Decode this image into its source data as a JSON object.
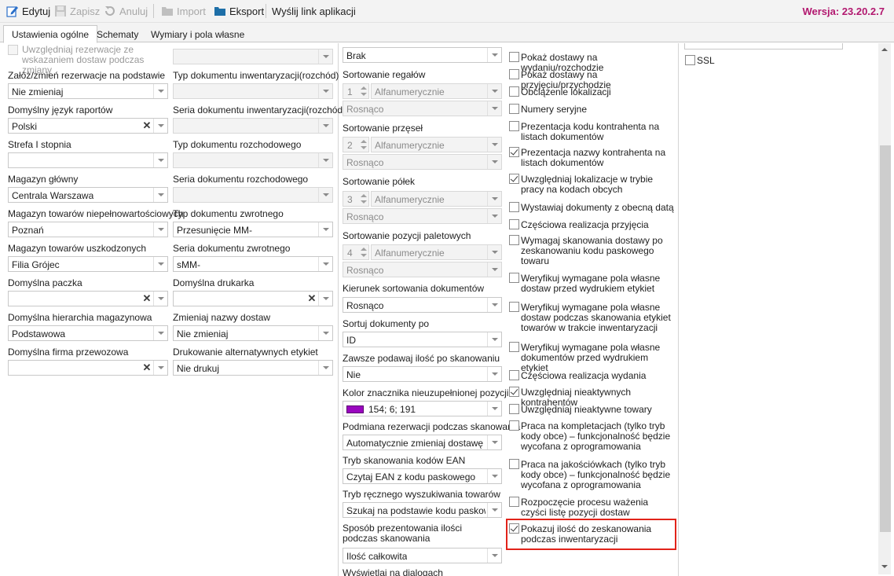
{
  "toolbar": {
    "edit": "Edytuj",
    "save": "Zapisz",
    "cancel": "Anuluj",
    "import": "Import",
    "export": "Eksport",
    "send_link": "Wyślij link aplikacji",
    "version": "Wersja: 23.20.2.7"
  },
  "tabs": [
    "Ustawienia ogólne",
    "Schematy",
    "Wymiary i pola własne"
  ],
  "col1": {
    "top_checkbox": "Uwzględniaj rezerwacje ze wskazaniem dostaw podczas zmiany",
    "l1": "Załóż/zmień rezerwacje na podstawie",
    "v1": "Nie zmieniaj",
    "l2": "Domyślny język raportów",
    "v2": "Polski",
    "l3": "Strefa I stopnia",
    "v3": "",
    "l4": "Magazyn główny",
    "v4": "Centrala Warszawa",
    "l5": "Magazyn towarów niepełnowartościowych",
    "v5": "Poznań",
    "l6": "Magazyn towarów uszkodzonych",
    "v6": "Filia Grójec",
    "l7": "Domyślna paczka",
    "v7": "",
    "l8": "Domyślna hierarchia magazynowa",
    "v8": "Podstawowa",
    "l9": "Domyślna firma przewozowa",
    "v9": ""
  },
  "col2": {
    "v0": "",
    "l1": "Typ dokumentu inwentaryzacji(rozchód)",
    "v1": "",
    "l2": "Seria dokumentu inwentaryzacji(rozchód)",
    "v2": "",
    "l3": "Typ dokumentu rozchodowego",
    "v3": "",
    "l4": "Seria dokumentu rozchodowego",
    "v4": "",
    "l5": "Typ dokumentu zwrotnego",
    "v5": "Przesunięcie MM-",
    "l6": "Seria dokumentu zwrotnego",
    "v6": "sMM-",
    "l7": "Domyślna drukarka",
    "v7": "",
    "l8": "Zmieniaj nazwy dostaw",
    "v8": "Nie zmieniaj",
    "l9": "Drukowanie alternatywnych etykiet",
    "v9": "Nie drukuj"
  },
  "col3": {
    "v0": "Brak",
    "sort_regaly": "Sortowanie regałów",
    "sort_regaly_n": "1",
    "sort_regaly_type": "Alfanumerycznie",
    "sort_regaly_dir": "Rosnąco",
    "sort_przesla": "Sortowanie przęseł",
    "sort_przesla_n": "2",
    "sort_przesla_type": "Alfanumerycznie",
    "sort_przesla_dir": "Rosnąco",
    "sort_polki": "Sortowanie półek",
    "sort_polki_n": "3",
    "sort_polki_type": "Alfanumerycznie",
    "sort_polki_dir": "Rosnąco",
    "sort_palety": "Sortowanie pozycji paletowych",
    "sort_palety_n": "4",
    "sort_palety_type": "Alfanumerycznie",
    "sort_palety_dir": "Rosnąco",
    "kierunek": "Kierunek sortowania dokumentów",
    "kierunek_v": "Rosnąco",
    "sortuj": "Sortuj dokumenty po",
    "sortuj_v": "ID",
    "zawsze": "Zawsze podawaj ilość po skanowaniu",
    "zawsze_v": "Nie",
    "kolor": "Kolor znacznika nieuzupełnionej pozycji",
    "kolor_v": "154; 6; 191",
    "kolor_hex": "#9a06bf",
    "podmiana": "Podmiana rezerwacji podczas skanowania",
    "podmiana_v": "Automatycznie zmieniaj dostawę po...",
    "tryb_ean": "Tryb skanowania kodów EAN",
    "tryb_ean_v": "Czytaj EAN z kodu paskowego",
    "tryb_reczny": "Tryb ręcznego wyszukiwania towarów",
    "tryb_reczny_v": "Szukaj na podstawie kodu paskowe...",
    "sposob": "Sposób prezentowania ilości podczas skanowania",
    "sposob_v": "Ilość całkowita",
    "cut": "Wyświetlaj na dialogach"
  },
  "col4": [
    {
      "label": "Pokaż dostawy na wydaniu/rozchodzie",
      "checked": false
    },
    {
      "label": "Pokaż dostawy na przyjęciu/przychodzie",
      "checked": false
    },
    {
      "label": "Obciążenie lokalizacji",
      "checked": false
    },
    {
      "label": "Numery seryjne",
      "checked": false
    },
    {
      "label": "Prezentacja kodu kontrahenta na listach dokumentów",
      "checked": false
    },
    {
      "label": "Prezentacja nazwy kontrahenta na listach dokumentów",
      "checked": true
    },
    {
      "label": "Uwzględniaj lokalizacje w trybie pracy na kodach obcych",
      "checked": true
    },
    {
      "label": "Wystawiaj dokumenty z obecną datą",
      "checked": false
    },
    {
      "label": "Częściowa realizacja przyjęcia",
      "checked": false
    },
    {
      "label": "Wymagaj skanowania dostawy po zeskanowaniu kodu paskowego towaru",
      "checked": false
    },
    {
      "label": "Weryfikuj wymagane pola własne dostaw przed wydrukiem etykiet",
      "checked": false
    },
    {
      "label": "Weryfikuj wymagane pola własne dostaw podczas skanowania etykiet towarów w trakcie inwentaryzacji",
      "checked": false
    },
    {
      "label": "Weryfikuj wymagane pola własne dokumentów przed wydrukiem etykiet",
      "checked": false
    },
    {
      "label": "Częściowa realizacja wydania",
      "checked": false
    },
    {
      "label": "Uwzględniaj nieaktywnych kontrahentów",
      "checked": true
    },
    {
      "label": "Uwzględniaj nieaktywne towary",
      "checked": false
    },
    {
      "label": "Praca na kompletacjach (tylko tryb kody obce) – funkcjonalność będzie wycofana z oprogramowania",
      "checked": false
    },
    {
      "label": "Praca na jakościówkach (tylko tryb kody obce) – funkcjonalność będzie wycofana z oprogramowania",
      "checked": false
    },
    {
      "label": "Rozpoczęcie procesu ważenia czyści listę pozycji dostaw",
      "checked": false
    },
    {
      "label": "Pokazuj ilość do zeskanowania podczas inwentaryzacji",
      "checked": true
    }
  ],
  "col5": {
    "ssl": "SSL"
  }
}
